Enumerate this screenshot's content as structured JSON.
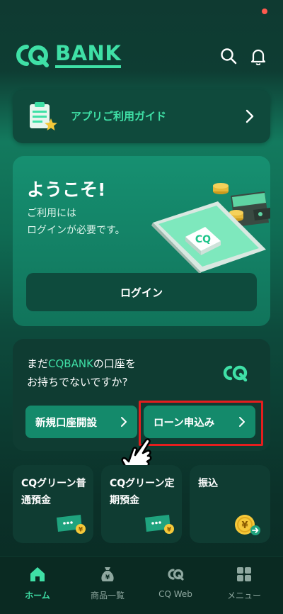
{
  "header": {
    "logo_text": "BANK",
    "icons": [
      "search-icon",
      "bell-icon"
    ],
    "notification_dot_color": "#ff5a4e"
  },
  "guide": {
    "label": "アプリご利用ガイド"
  },
  "welcome": {
    "title": "ようこそ!",
    "subtitle_line1": "ご利用には",
    "subtitle_line2": "ログインが必要です。",
    "login_label": "ログイン"
  },
  "account": {
    "question_prefix": "まだ",
    "question_brand": "CQBANK",
    "question_suffix": "の口座を",
    "question_line2": "お持ちでないですか?",
    "open_account_label": "新規口座開設",
    "loan_label": "ローン申込み"
  },
  "tiles": [
    {
      "label": "CQグリーン普通預金",
      "icon": "card-yen-icon"
    },
    {
      "label": "CQグリーン定期預金",
      "icon": "card-yen-icon"
    },
    {
      "label": "振込",
      "icon": "yen-coin-transfer-icon"
    }
  ],
  "nav": [
    {
      "label": "ホーム",
      "icon": "home-icon",
      "active": true
    },
    {
      "label": "商品一覧",
      "icon": "money-bag-icon",
      "active": false
    },
    {
      "label": "CQ Web",
      "icon": "cq-logo-icon",
      "active": false
    },
    {
      "label": "メニュー",
      "icon": "grid-menu-icon",
      "active": false
    }
  ],
  "colors": {
    "accent": "#3fe0a6",
    "card": "#0f3c32",
    "button": "#148a6b",
    "highlight_box": "#e41e1e"
  }
}
